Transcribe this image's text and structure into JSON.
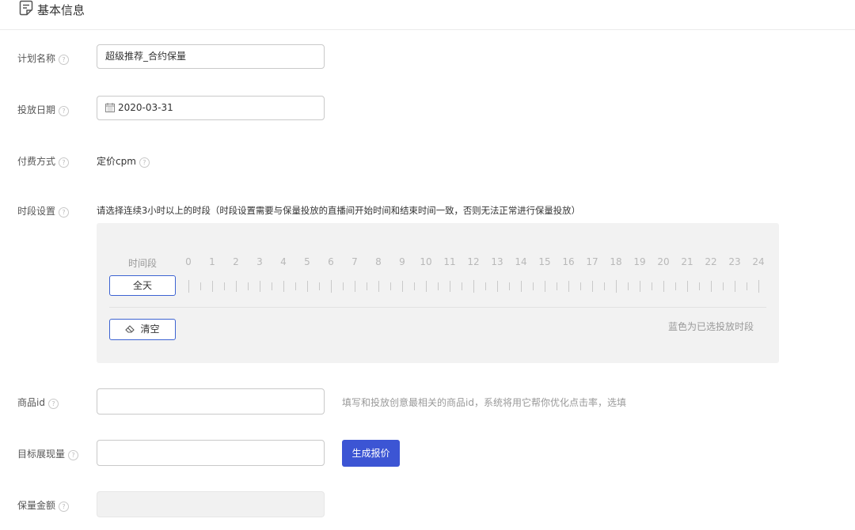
{
  "header": {
    "title": "基本信息",
    "icon": "document-icon"
  },
  "plan_name": {
    "label": "计划名称",
    "value": "超级推荐_合约保量"
  },
  "delivery_date": {
    "label": "投放日期",
    "value": "2020-03-31"
  },
  "payment": {
    "label": "付费方式",
    "value": "定价cpm"
  },
  "time_slot": {
    "label": "时段设置",
    "instruction": "请选择连续3小时以上的时段（时段设置需要与保量投放的直播间开始时间和结束时间一致，否则无法正常进行保量投放）",
    "timeline_label": "时间段",
    "hours": [
      "0",
      "1",
      "2",
      "3",
      "4",
      "5",
      "6",
      "7",
      "8",
      "9",
      "10",
      "11",
      "12",
      "13",
      "14",
      "15",
      "16",
      "17",
      "18",
      "19",
      "20",
      "21",
      "22",
      "23",
      "24"
    ],
    "all_day_label": "全天",
    "clear_label": "清空",
    "legend": "蓝色为已选投放时段"
  },
  "product_id": {
    "label": "商品id",
    "value": "",
    "hint": "填写和投放创意最相关的商品id，系统将用它帮你优化点击率，选填"
  },
  "target_impressions": {
    "label": "目标展现量",
    "value": "",
    "button_label": "生成报价"
  },
  "guarantee_amount": {
    "label": "保量金额",
    "value": ""
  },
  "colors": {
    "primary": "#3c55d4",
    "border_active": "#3d63d2",
    "panel_bg": "#f2f2f2"
  }
}
